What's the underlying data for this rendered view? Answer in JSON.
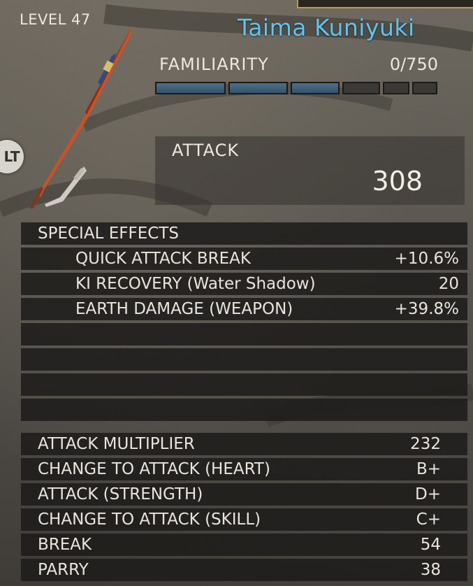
{
  "header": {
    "level": "LEVEL 47",
    "weapon_name": "Taima Kuniyuki",
    "lt_badge": "LT"
  },
  "familiarity": {
    "label": "FAMILIARITY",
    "value": "0/750",
    "segments_filled": 3,
    "segments_total": 6
  },
  "attack": {
    "label": "ATTACK",
    "value": "308"
  },
  "special_effects": {
    "header": "SPECIAL EFFECTS",
    "items": [
      {
        "label": "QUICK ATTACK BREAK",
        "value": "+10.6%"
      },
      {
        "label": "KI RECOVERY (Water Shadow)",
        "value": "20"
      },
      {
        "label": "EARTH DAMAGE (WEAPON)",
        "value": "+39.8%"
      }
    ]
  },
  "stats": [
    {
      "label": "ATTACK MULTIPLIER",
      "value": "232"
    },
    {
      "label": "CHANGE TO ATTACK (HEART)",
      "value": "B+"
    },
    {
      "label": "ATTACK (STRENGTH)",
      "value": "D+"
    },
    {
      "label": "CHANGE TO ATTACK (SKILL)",
      "value": "C+"
    },
    {
      "label": "BREAK",
      "value": "54"
    },
    {
      "label": "PARRY",
      "value": "38"
    }
  ],
  "colors": {
    "name": "#61c3ef",
    "familiarity_fill": "#4d6f88",
    "row_background": "#1c1b1a",
    "frame_accent": "#c89a3a"
  },
  "icons": {
    "weapon_image": "katana-image",
    "weapon_type": "sword-icon"
  }
}
